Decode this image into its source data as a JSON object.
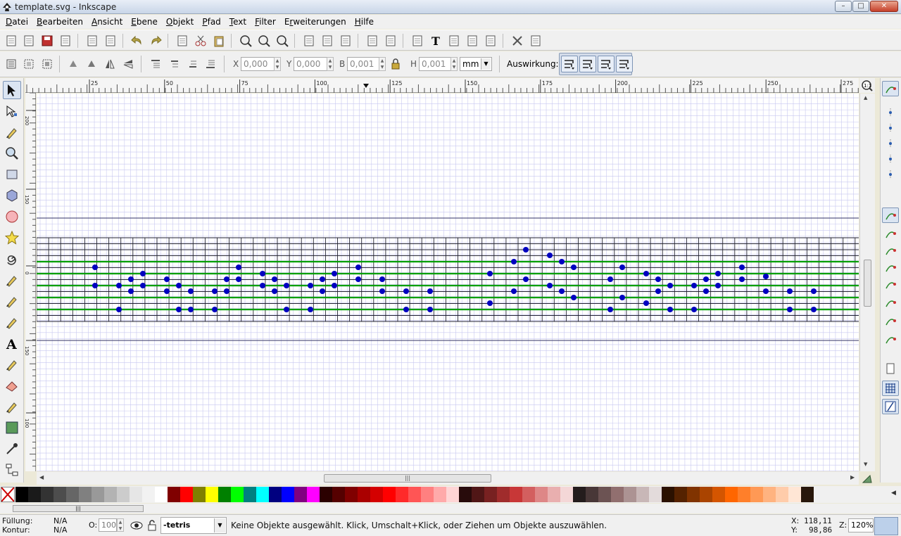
{
  "window": {
    "title": "template.svg - Inkscape"
  },
  "menubar": [
    {
      "label": "Datei",
      "accel": "D",
      "rest": "atei"
    },
    {
      "label": "Bearbeiten",
      "accel": "B",
      "rest": "earbeiten"
    },
    {
      "label": "Ansicht",
      "accel": "A",
      "rest": "nsicht"
    },
    {
      "label": "Ebene",
      "accel": "E",
      "rest": "bene"
    },
    {
      "label": "Objekt",
      "accel": "O",
      "rest": "bjekt"
    },
    {
      "label": "Pfad",
      "accel": "P",
      "rest": "fad"
    },
    {
      "label": "Text",
      "accel": "T",
      "rest": "ext"
    },
    {
      "label": "Filter",
      "accel": "F",
      "rest": "ilter"
    },
    {
      "label": "Erweiterungen",
      "accel": "r",
      "pre": "E",
      "rest": "weiterungen"
    },
    {
      "label": "Hilfe",
      "accel": "H",
      "rest": "ilfe"
    }
  ],
  "controls": {
    "x_label": "X",
    "x_value": "0,000",
    "y_label": "Y",
    "y_value": "0,000",
    "w_label": "B",
    "w_value": "0,001",
    "h_label": "H",
    "h_value": "0,001",
    "unit": "mm",
    "effect_label": "Auswirkung:"
  },
  "ruler": {
    "h_labels": [
      "25",
      "50",
      "75",
      "100",
      "125",
      "150",
      "175",
      "200",
      "225",
      "250",
      "275"
    ],
    "v_labels": [
      "200",
      "150",
      "0",
      "150",
      "100"
    ]
  },
  "document": {
    "staff_line_color": "#00a000",
    "dot_color": "#0000c0",
    "grid_color": "#c8c8f0"
  },
  "status": {
    "fill_label": "Füllung:",
    "fill_value": "N/A",
    "stroke_label": "Kontur:",
    "stroke_value": "N/A",
    "opacity_label": "O:",
    "opacity_value": "100",
    "layer": "-tetris",
    "message": "Keine Objekte ausgewählt. Klick, Umschalt+Klick, oder Ziehen um Objekte auszuwählen.",
    "x_label": "X:",
    "x_value": "118,11",
    "y_label": "Y:",
    "y_value": "98,86",
    "zoom_label": "Z:",
    "zoom_value": "120%"
  },
  "palette": [
    "#000000",
    "#1a1a1a",
    "#333333",
    "#4d4d4d",
    "#666666",
    "#808080",
    "#999999",
    "#b3b3b3",
    "#cccccc",
    "#e6e6e6",
    "#f2f2f2",
    "#ffffff",
    "#800000",
    "#ff0000",
    "#808000",
    "#ffff00",
    "#008000",
    "#00ff00",
    "#008080",
    "#00ffff",
    "#000080",
    "#0000ff",
    "#800080",
    "#ff00ff",
    "#2b0000",
    "#550000",
    "#800000",
    "#aa0000",
    "#d40000",
    "#ff0000",
    "#ff2a2a",
    "#ff5555",
    "#ff8080",
    "#ffaaaa",
    "#ffd5d5",
    "#280b0b",
    "#501616",
    "#782121",
    "#a02c2c",
    "#c83737",
    "#d35f5f",
    "#de8787",
    "#e9afaf",
    "#f4d7d7",
    "#241c1c",
    "#483737",
    "#6c5353",
    "#916f6f",
    "#ac9393",
    "#c8b7b7",
    "#e3dbdb",
    "#2b1100",
    "#552200",
    "#803300",
    "#aa4400",
    "#d45500",
    "#ff6600",
    "#ff7f2a",
    "#ff9955",
    "#ffb380",
    "#ffccaa",
    "#ffe6d5",
    "#28170b"
  ]
}
